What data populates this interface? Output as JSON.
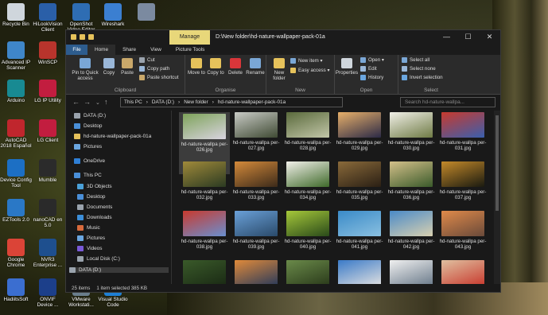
{
  "desktop_icons": [
    {
      "label": "Recycle Bin",
      "color": "#cfd6dc"
    },
    {
      "label": "HiLookVision Client",
      "color": "#2a5fa8"
    },
    {
      "label": "OpenShot Video Editor",
      "color": "#2e6db3"
    },
    {
      "label": "Wireshark",
      "color": "#3b7fd1"
    },
    {
      "label": "",
      "color": "#7b8aa0"
    },
    {
      "label": "Advanced IP Scanner",
      "color": "#3f86c9"
    },
    {
      "label": "WinSCP",
      "color": "#b8342c"
    },
    {
      "label": "Arduino",
      "color": "#188a92"
    },
    {
      "label": "LG IP Utility",
      "color": "#c21d3f"
    },
    {
      "label": "AutoCAD 2018 Español",
      "color": "#c0262d"
    },
    {
      "label": "LG Client",
      "color": "#c21d3f"
    },
    {
      "label": "Device Config Tool",
      "color": "#1c6fc4"
    },
    {
      "label": "Mumble",
      "color": "#2b2b2b"
    },
    {
      "label": "EZTools 2.0",
      "color": "#2a78c6"
    },
    {
      "label": "nanoCAD en 5.0",
      "color": "#2a2a2a"
    },
    {
      "label": "Google Chrome",
      "color": "#db4437"
    },
    {
      "label": "NVR3 Enterprise ...",
      "color": "#1e4f8e"
    },
    {
      "label": "HadiitsSoft",
      "color": "#3b6ed0"
    },
    {
      "label": "ONVIF Device ...",
      "color": "#1c3f8a"
    },
    {
      "label": "VMware Workstati...",
      "color": "#6a7d8c"
    },
    {
      "label": "Visual Studio Code",
      "color": "#1f7fd4"
    }
  ],
  "window": {
    "manage_label": "Manage",
    "title": "D:\\New folder\\hd-nature-wallpaper-pack-01a",
    "controls": {
      "minimize": "—",
      "maximize": "☐",
      "close": "✕"
    }
  },
  "tabs": [
    "File",
    "Home",
    "Share",
    "View",
    "Picture Tools"
  ],
  "ribbon": {
    "clipboard": {
      "name": "Clipboard",
      "pin": "Pin to Quick access",
      "copy": "Copy",
      "paste": "Paste",
      "cut": "Cut",
      "copy_path": "Copy path",
      "paste_shortcut": "Paste shortcut"
    },
    "organise": {
      "name": "Organise",
      "move_to": "Move to",
      "copy_to": "Copy to",
      "delete": "Delete",
      "rename": "Rename"
    },
    "new": {
      "name": "New",
      "new_folder": "New folder",
      "new_item": "New item ▾",
      "easy_access": "Easy access ▾"
    },
    "open": {
      "name": "Open",
      "properties": "Properties",
      "open": "Open ▾",
      "edit": "Edit",
      "history": "History"
    },
    "select": {
      "name": "Select",
      "select_all": "Select all",
      "select_none": "Select none",
      "invert": "Invert selection"
    }
  },
  "address": {
    "crumbs": [
      "This PC",
      "DATA (D:)",
      "New folder",
      "hd-nature-wallpaper-pack-01a"
    ],
    "search_placeholder": "Search hd-nature-wallpa..."
  },
  "sidebar": [
    {
      "label": "DATA (D:)",
      "color": "#9aa3ad",
      "indent": 0
    },
    {
      "label": "Desktop",
      "color": "#4a8fd8",
      "indent": 0
    },
    {
      "label": "hd-nature-wallpaper-pack-01a",
      "color": "#e6c25b",
      "indent": 0
    },
    {
      "label": "Pictures",
      "color": "#6aa6e0",
      "indent": 0
    },
    {
      "label": "OneDrive",
      "color": "#2f7fd6",
      "indent": 0
    },
    {
      "label": "This PC",
      "color": "#4a8fd8",
      "indent": 0
    },
    {
      "label": "3D Objects",
      "color": "#4aa0d8",
      "indent": 1
    },
    {
      "label": "Desktop",
      "color": "#4a8fd8",
      "indent": 1
    },
    {
      "label": "Documents",
      "color": "#9aa3ad",
      "indent": 1
    },
    {
      "label": "Downloads",
      "color": "#3c8ed8",
      "indent": 1
    },
    {
      "label": "Music",
      "color": "#d86a3c",
      "indent": 1
    },
    {
      "label": "Pictures",
      "color": "#6aa6e0",
      "indent": 1
    },
    {
      "label": "Videos",
      "color": "#7a5ad8",
      "indent": 1
    },
    {
      "label": "Local Disk (C:)",
      "color": "#9aa3ad",
      "indent": 1
    },
    {
      "label": "DATA (D:)",
      "color": "#9aa3ad",
      "indent": 1
    }
  ],
  "files": [
    {
      "name": "hd-nature-wallpa per-026.jpg",
      "colors": [
        "#7ea35a",
        "#d9d4e0"
      ]
    },
    {
      "name": "hd-nature-wallpa per-027.jpg",
      "colors": [
        "#c9cbc6",
        "#3f4a33"
      ]
    },
    {
      "name": "hd-nature-wallpa per-028.jpg",
      "colors": [
        "#5a6a3c",
        "#c2c6a8"
      ]
    },
    {
      "name": "hd-nature-wallpa per-029.jpg",
      "colors": [
        "#e8b06a",
        "#2b2a46"
      ]
    },
    {
      "name": "hd-nature-wallpa per-030.jpg",
      "colors": [
        "#f1f0e8",
        "#6f7b45"
      ]
    },
    {
      "name": "hd-nature-wallpa per-031.jpg",
      "colors": [
        "#c83a2e",
        "#3a5fae"
      ]
    },
    {
      "name": "hd-nature-wallpa per-032.jpg",
      "colors": [
        "#a08a3a",
        "#2b3a22"
      ]
    },
    {
      "name": "hd-nature-wallpa per-033.jpg",
      "colors": [
        "#d48a3a",
        "#3c2a1a"
      ]
    },
    {
      "name": "hd-nature-wallpa per-034.jpg",
      "colors": [
        "#f2f0ea",
        "#3f6a2a"
      ]
    },
    {
      "name": "hd-nature-wallpa per-035.jpg",
      "colors": [
        "#8a6a3a",
        "#2a1f14"
      ]
    },
    {
      "name": "hd-nature-wallpa per-036.jpg",
      "colors": [
        "#d4c08a",
        "#3a5a2a"
      ]
    },
    {
      "name": "hd-nature-wallpa per-037.jpg",
      "colors": [
        "#c48a2a",
        "#1a1a10"
      ]
    },
    {
      "name": "hd-nature-wallpa per-038.jpg",
      "colors": [
        "#c83a2e",
        "#6a8fd0"
      ]
    },
    {
      "name": "hd-nature-wallpa per-039.jpg",
      "colors": [
        "#6aa0d8",
        "#2a4a6a"
      ]
    },
    {
      "name": "hd-nature-wallpa per-040.jpg",
      "colors": [
        "#a6c83a",
        "#2a4a1a"
      ]
    },
    {
      "name": "hd-nature-wallpa per-041.jpg",
      "colors": [
        "#3a8ac8",
        "#8ac0e0"
      ]
    },
    {
      "name": "hd-nature-wallpa per-042.jpg",
      "colors": [
        "#4a8ac8",
        "#d8d0b0"
      ]
    },
    {
      "name": "hd-nature-wallpa per-043.jpg",
      "colors": [
        "#e08a4a",
        "#6a4a3a"
      ]
    },
    {
      "name": "",
      "colors": [
        "#3a5a2a",
        "#1a2a14"
      ]
    },
    {
      "name": "",
      "colors": [
        "#e08a3a",
        "#2a3a5a"
      ]
    },
    {
      "name": "",
      "colors": [
        "#6a8a4a",
        "#2a3a1a"
      ]
    },
    {
      "name": "",
      "colors": [
        "#3a7ac8",
        "#e0e0e0"
      ]
    },
    {
      "name": "",
      "colors": [
        "#f0f0f0",
        "#6a7a8a"
      ]
    },
    {
      "name": "",
      "colors": [
        "#e0c0a0",
        "#c83a2e"
      ]
    }
  ],
  "status": {
    "count": "25 items",
    "selected": "1 item selected  385 KB"
  }
}
